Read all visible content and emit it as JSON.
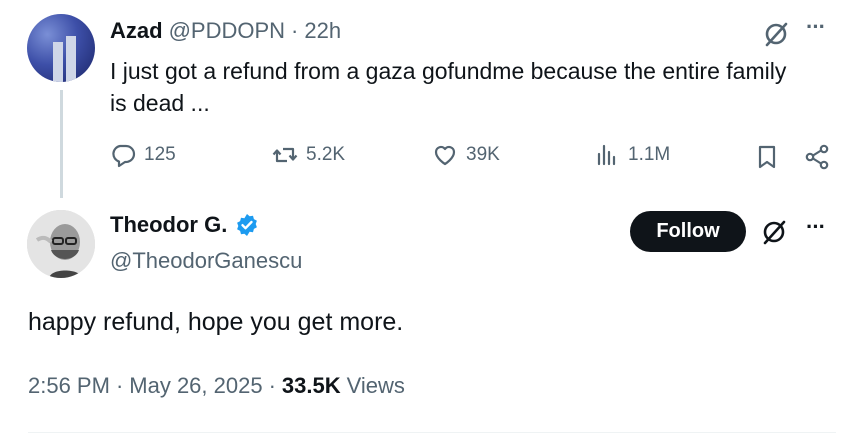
{
  "parent_tweet": {
    "author_name": "Azad",
    "handle": "@PDDOPN",
    "separator": "·",
    "time": "22h",
    "text": "I just got a refund from a gaza gofundme because the entire family is dead ...",
    "actions": {
      "replies": "125",
      "reposts": "5.2K",
      "likes": "39K",
      "views": "1.1M"
    },
    "icons": [
      "reply-icon",
      "repost-icon",
      "like-icon",
      "views-icon",
      "bookmark-icon",
      "share-icon",
      "grok-icon",
      "more-icon"
    ]
  },
  "reply_tweet": {
    "author_name": "Theodor G.",
    "handle": "@TheodorGanescu",
    "verified": true,
    "follow_label": "Follow",
    "text": "happy refund, hope you get more.",
    "time": "2:56 PM",
    "separator1": "·",
    "date": "May 26, 2025",
    "separator2": "·",
    "views_count": "33.5K",
    "views_label": "Views"
  },
  "colors": {
    "text_primary": "#0f1419",
    "text_secondary": "#536471",
    "verified_blue": "#1d9bf0",
    "follow_bg": "#0f1419",
    "thread_line": "#cfd9de"
  }
}
